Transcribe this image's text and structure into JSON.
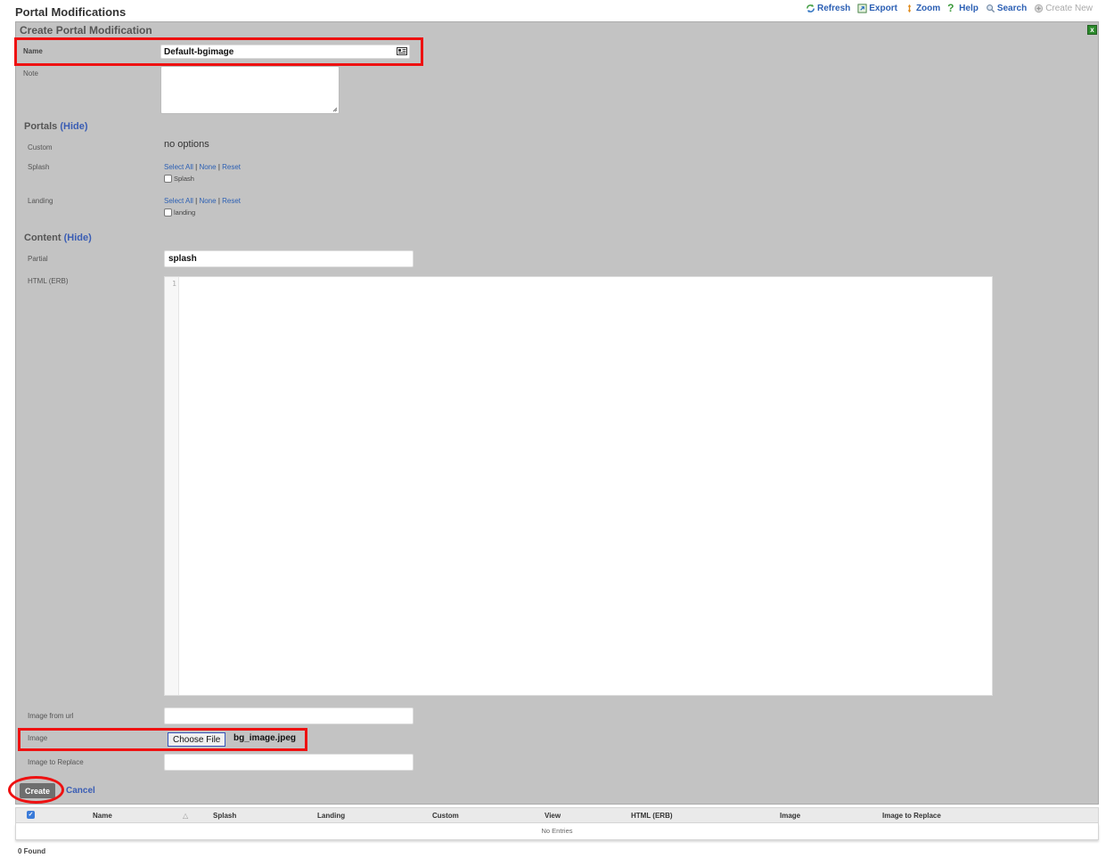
{
  "header": {
    "title": "Portal Modifications",
    "toolbar": [
      {
        "label": "Refresh",
        "icon": "refresh-icon"
      },
      {
        "label": "Export",
        "icon": "export-icon"
      },
      {
        "label": "Zoom",
        "icon": "zoom-icon"
      },
      {
        "label": "Help",
        "icon": "help-icon"
      },
      {
        "label": "Search",
        "icon": "search-icon"
      },
      {
        "label": "Create New",
        "icon": "create-new-icon"
      }
    ]
  },
  "form": {
    "title": "Create Portal Modification",
    "close_glyph": "x",
    "name_label": "Name",
    "name_value": "Default-bgimage",
    "note_label": "Note",
    "note_value": "",
    "portals_heading": "Portals",
    "hide_label": "(Hide)",
    "custom_label": "Custom",
    "custom_value": "no options",
    "splash_label": "Splash",
    "splash_links": {
      "select_all": "Select All",
      "sep": "|",
      "none": "None",
      "reset": "Reset"
    },
    "splash_checkbox": "Splash",
    "landing_label": "Landing",
    "landing_links": {
      "select_all": "Select All",
      "sep": "|",
      "none": "None",
      "reset": "Reset"
    },
    "landing_checkbox": "landing",
    "content_heading": "Content",
    "partial_label": "Partial",
    "partial_value": "splash",
    "html_label": "HTML (ERB)",
    "editor_line": "1",
    "image_url_label": "Image from url",
    "image_url_value": "",
    "image_label": "Image",
    "choose_file": "Choose File",
    "file_name": "bg_image.jpeg",
    "replace_label": "Image to Replace",
    "replace_value": "",
    "create": "Create",
    "cancel": "Cancel"
  },
  "table": {
    "columns": [
      "Name",
      "Splash",
      "Landing",
      "Custom",
      "View",
      "HTML (ERB)",
      "Image",
      "Image to Replace"
    ],
    "sort_glyph": "△",
    "check_glyph": "✓",
    "empty": "No Entries",
    "found": "0 Found"
  },
  "colors": {
    "panel": "#c3c3c3",
    "link": "#2b5fb4",
    "highlight": "#ee1111",
    "button": "#6e6e6e"
  }
}
